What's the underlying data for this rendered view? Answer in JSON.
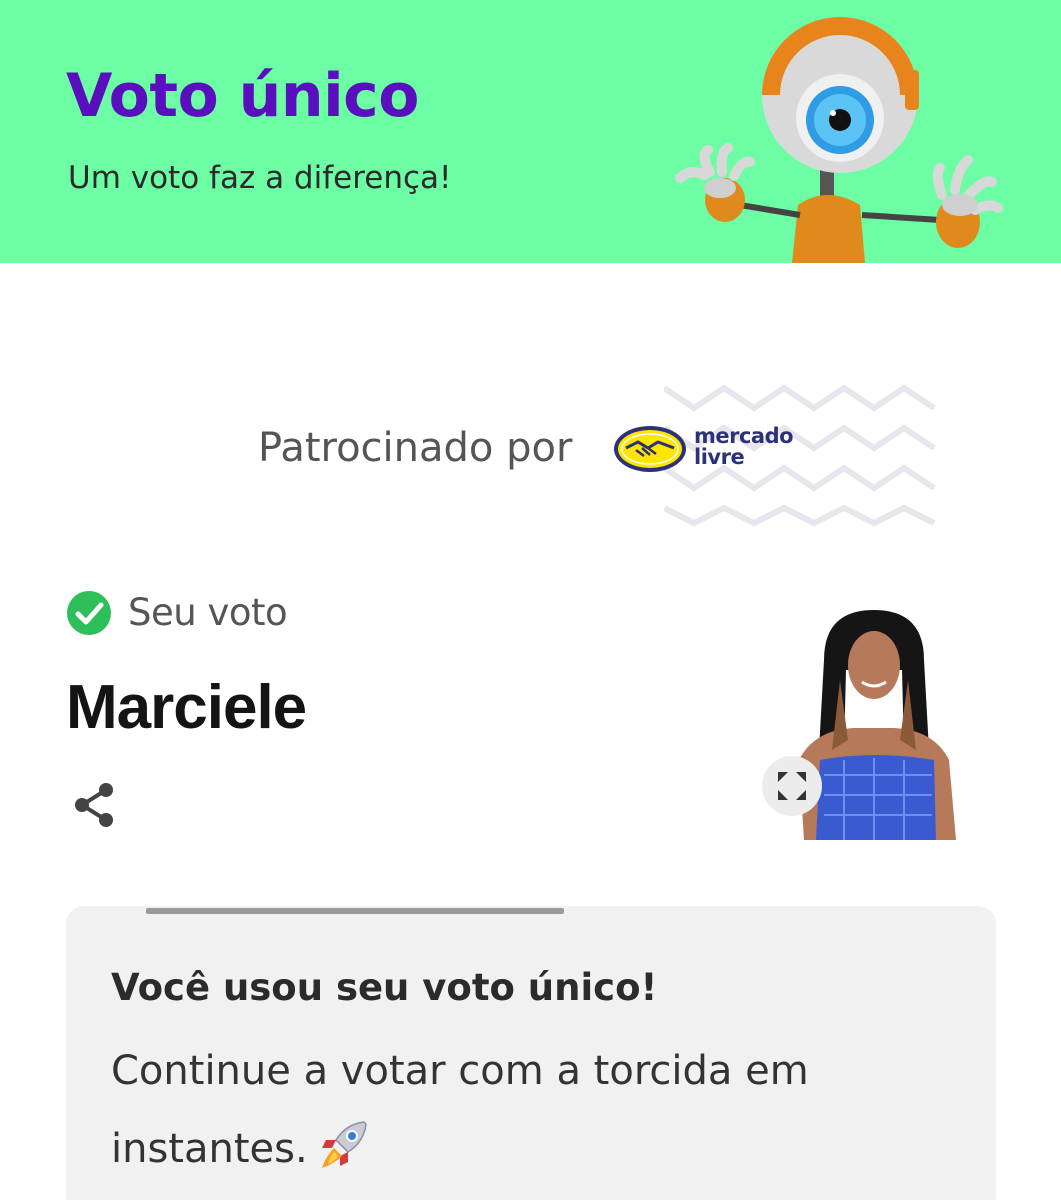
{
  "header": {
    "title": "Voto único",
    "subtitle": "Um voto faz a diferença!",
    "mascot_icon": "big-brother-eye-mascot",
    "background_color": "#6dfda4",
    "title_color": "#5a0fbf"
  },
  "sponsor": {
    "label": "Patrocinado por",
    "logo_text": "mercado\nlivre",
    "logo_icon": "handshake-logo-icon"
  },
  "vote": {
    "label": "Seu voto",
    "status_icon": "check-circle-icon",
    "status_color": "#2fbf5a",
    "candidate_name": "Marciele",
    "share_icon": "share-icon",
    "expand_icon": "expand-icon"
  },
  "message": {
    "title": "Você usou seu voto único!",
    "body": "Continue a votar com a torcida em instantes.",
    "emoji_icon": "rocket-icon"
  }
}
